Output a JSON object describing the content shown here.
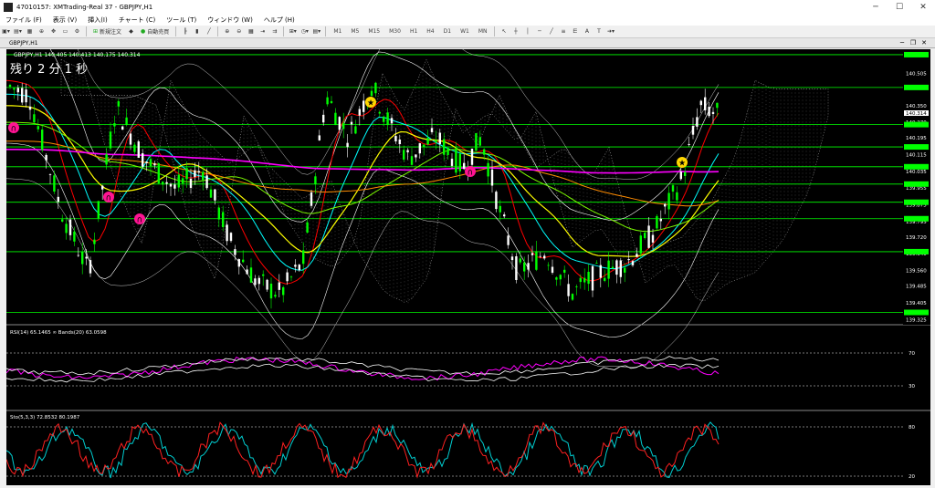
{
  "window": {
    "title": "47010157: XMTrading-Real 37 - GBPJPY,H1"
  },
  "menu": [
    "ファイル (F)",
    "表示 (V)",
    "挿入(I)",
    "チャート (C)",
    "ツール (T)",
    "ウィンドウ (W)",
    "ヘルプ (H)"
  ],
  "toolbar": {
    "new_order": "新規注文",
    "auto_trade": "自動売買",
    "timeframes": [
      "M1",
      "M5",
      "M15",
      "M30",
      "H1",
      "H4",
      "D1",
      "W1",
      "MN"
    ]
  },
  "tab": {
    "label": "GBPJPY,H1"
  },
  "chart": {
    "ohlc_header": "GBPJPY,H1 140.405 140.413 140.175 140.314",
    "countdown": "残り 2 分 1 秒",
    "price_labels": [
      "140.594",
      "140.505",
      "140.437",
      "140.350",
      "140.314",
      "140.270",
      "140.195",
      "140.115",
      "140.035",
      "139.955",
      "139.875",
      "139.795",
      "139.720",
      "139.640",
      "139.560",
      "139.485",
      "139.405",
      "139.325"
    ],
    "green_levels": [
      140.594,
      140.437,
      140.259,
      140.152,
      140.057,
      139.974,
      139.887,
      139.808,
      139.65,
      139.359
    ],
    "current_price": "140.314",
    "colors": {
      "bg": "#000000",
      "green": "#00ff00",
      "bull": "#00ff00",
      "bear": "#ffffff",
      "tenkan": "#ff0000",
      "kijun": "#00ffff",
      "ema_fast": "#ffff00",
      "ema_mid": "#ff8c00",
      "ema_slow": "#ff00ff",
      "bb": "#ffffff"
    }
  },
  "rsi": {
    "label": "RSI(14) 65.1465  ∞ Bands(20) 63.0598",
    "levels": [
      "70",
      "30"
    ]
  },
  "stoch": {
    "label": "Sto(5,3,3) 72.8532 80.1987",
    "levels": [
      "80",
      "20"
    ]
  }
}
